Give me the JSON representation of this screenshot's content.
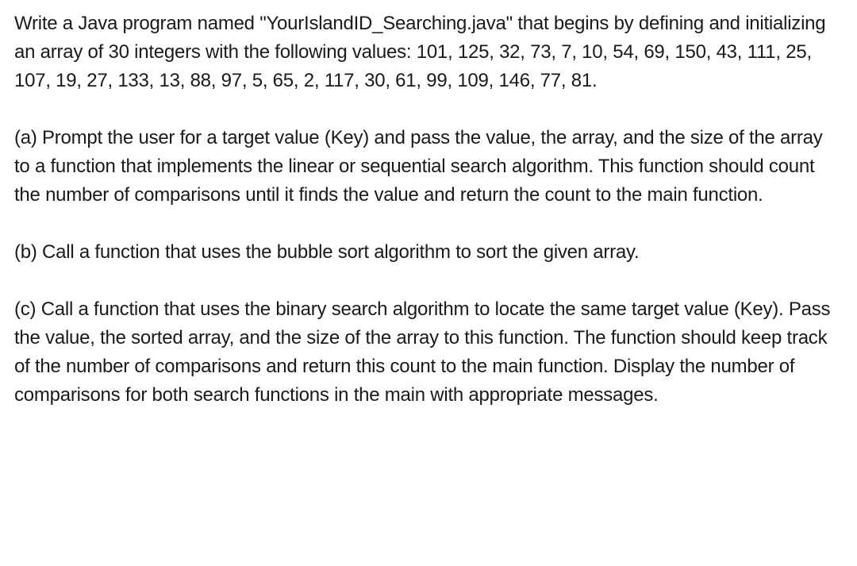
{
  "paragraphs": {
    "intro": "Write a Java program named \"YourIslandID_Searching.java\" that begins by defining and initializing an array of 30 integers with the following values: 101, 125, 32, 73, 7, 10, 54, 69, 150, 43, 111, 25, 107, 19, 27, 133, 13, 88, 97, 5, 65, 2, 117, 30, 61, 99, 109, 146, 77, 81.",
    "part_a": "(a) Prompt the user for a target value (Key) and pass the value, the array, and the size of the array to a function that implements the linear or sequential search algorithm. This function should count the number of comparisons until it finds the value and return the count to the main function.",
    "part_b": "(b) Call a function that uses the bubble sort algorithm to sort the given array.",
    "part_c": "(c) Call a function that uses the binary search algorithm to locate the same target value (Key). Pass the value, the sorted array, and the size of the array to this function. The function should keep track of the number of comparisons and return this count to the main function. Display the number of comparisons for both search functions in the main with appropriate messages."
  }
}
